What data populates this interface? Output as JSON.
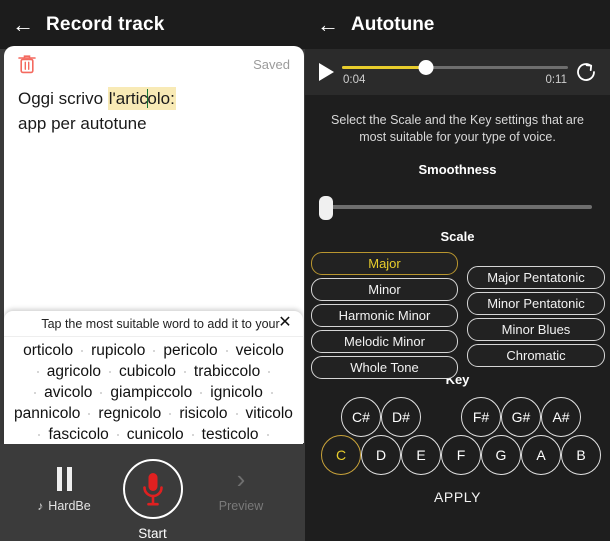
{
  "left_panel": {
    "header": {
      "back_icon": "back-arrow-icon",
      "title": "Record track"
    },
    "note": {
      "trash_icon": "trash-icon",
      "status": "Saved",
      "line1_before": "Oggi scrivo ",
      "line1_highlight_a": "l'artic",
      "line1_highlight_b": "olo:",
      "line2": "app per autotune"
    },
    "suggestions": {
      "prompt": "Tap the most suitable word to add it to your",
      "close_icon": "close-icon",
      "rows": [
        [
          "orticolo",
          "rupicolo",
          "pericolo",
          "veicolo"
        ],
        [
          "agricolo",
          "cubicolo",
          "trabiccolo"
        ],
        [
          "avicolo",
          "giampiccolo",
          "ignicolo"
        ],
        [
          "pannicolo",
          "regnicolo",
          "risicolo",
          "viticolo"
        ],
        [
          "fascicolo",
          "cunicolo",
          "testicolo"
        ]
      ]
    },
    "bottom_bar": {
      "pause_icon": "pause-icon",
      "track_name": "HardBe",
      "music_note_icon": "music-note-icon",
      "record_icon": "microphone-icon",
      "record_label": "Start",
      "next_icon": "chevron-right-icon",
      "preview_label": "Preview"
    }
  },
  "right_panel": {
    "header": {
      "back_icon": "back-arrow-icon",
      "title": "Autotune"
    },
    "player": {
      "play_icon": "play-icon",
      "current_time": "0:04",
      "total_time": "0:11",
      "loop_icon": "loop-icon",
      "progress_percent": 37
    },
    "description": "Select the Scale and the Key settings that are most suitable for your type of voice.",
    "smoothness": {
      "title": "Smoothness",
      "value_percent": 0
    },
    "scale": {
      "title": "Scale",
      "selected": "Major",
      "left_column": [
        "Major",
        "Minor",
        "Harmonic Minor",
        "Melodic Minor",
        "Whole Tone"
      ],
      "right_column": [
        "Major Pentatonic",
        "Minor Pentatonic",
        "Minor Blues",
        "Chromatic"
      ]
    },
    "key": {
      "title": "Key",
      "selected": "C",
      "sharps": [
        "C#",
        "D#",
        "F#",
        "G#",
        "A#"
      ],
      "naturals": [
        "C",
        "D",
        "E",
        "F",
        "G",
        "A",
        "B"
      ]
    },
    "apply_label": "APPLY"
  },
  "colors": {
    "accent_yellow": "#e8cd2c",
    "record_red": "#e02020",
    "highlight_yellow": "#f8eab6",
    "caret_green": "#137333"
  }
}
